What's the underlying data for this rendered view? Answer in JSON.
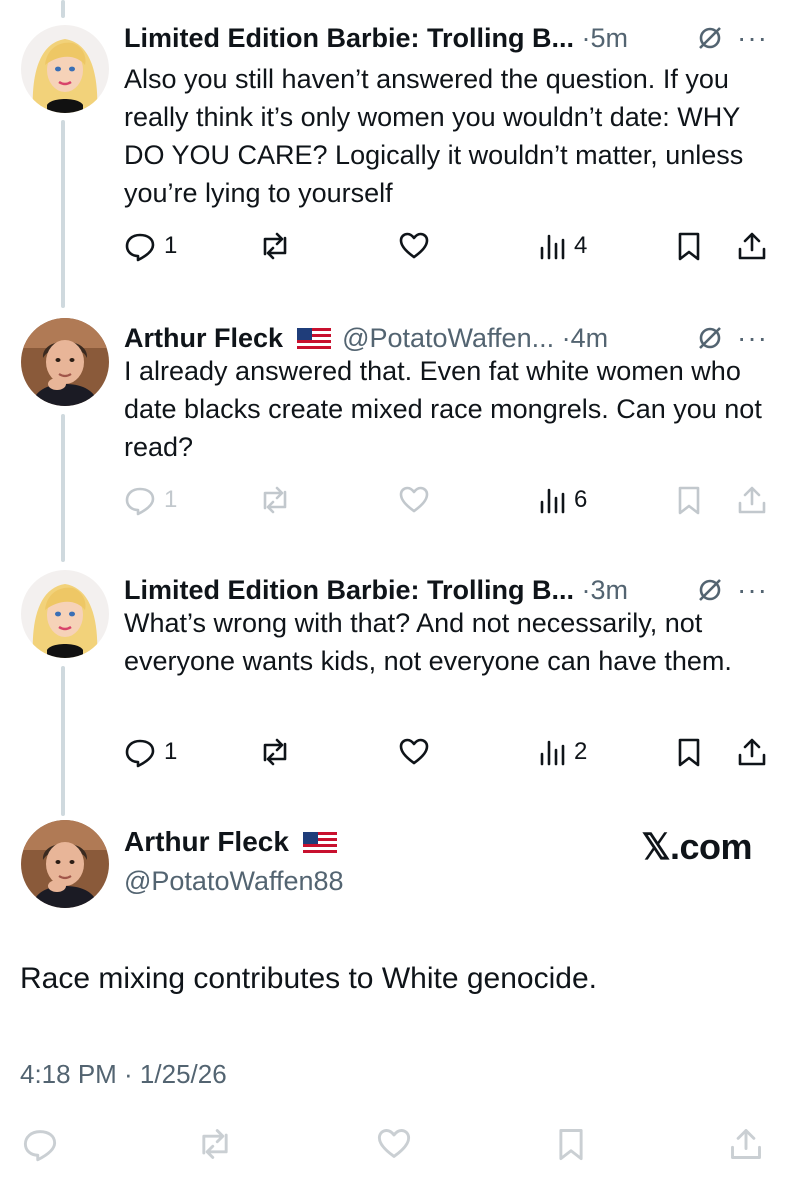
{
  "thread": [
    {
      "author_name": "Limited Edition Barbie: Trolling B...",
      "handle": "",
      "separator": "·",
      "time": "5m",
      "text": "Also you still haven’t answered the question. If you really think it’s only women you wouldn’t date: WHY DO YOU CARE? Logically it wouldn’t matter, unless you’re lying to yourself",
      "replies": "1",
      "views": "4",
      "avatar": "barbie-avatar"
    },
    {
      "author_name": "Arthur Fleck",
      "handle": "@PotatoWaffen...",
      "separator": "·",
      "time": "4m",
      "text": "I already answered that. Even fat white women who date blacks create mixed race mongrels. Can you not read?",
      "replies": "1",
      "views": "6",
      "avatar": "boy-avatar"
    },
    {
      "author_name": "Limited Edition Barbie: Trolling B...",
      "handle": "",
      "separator": "·",
      "time": "3m",
      "text": "What’s wrong with that? And not necessarily, not everyone wants kids, not everyone can have them.",
      "replies": "1",
      "views": "2",
      "avatar": "barbie-avatar"
    }
  ],
  "main_tweet": {
    "author_name": "Arthur Fleck",
    "handle": "@PotatoWaffen88",
    "text": "Race mixing contributes to White genocide.",
    "timestamp": "4:18 PM · 1/25/26",
    "watermark": "𝕏.com"
  },
  "more_label": "···",
  "colors": {
    "text": "#0f1419",
    "secondary": "#536471",
    "thread_line": "#cfd9de"
  }
}
